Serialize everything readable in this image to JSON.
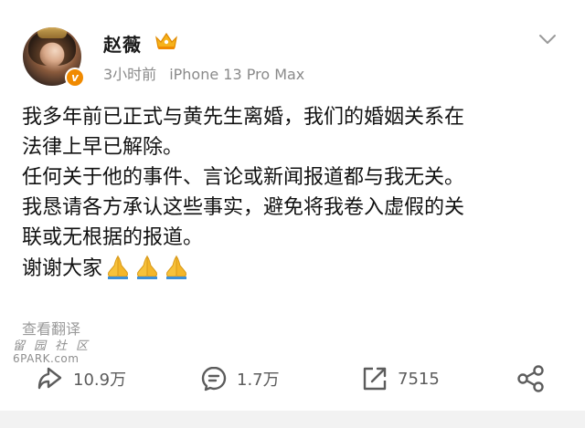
{
  "post": {
    "author_name": "赵薇",
    "verified_mark": "v",
    "time": "3小时前",
    "device": "iPhone 13 Pro Max",
    "content_lines": [
      "我多年前已正式与黄先生离婚，我们的婚姻关系在",
      "法律上早已解除。",
      "任何关于他的事件、言论或新闻报道都与我无关。",
      "我恳请各方承认这些事实，避免将我卷入虚假的关",
      "联或无根据的报道。",
      "谢谢大家"
    ],
    "emoji": "praying-hands-icon",
    "emoji_count": 3,
    "translate_label": "查看翻译"
  },
  "watermark": {
    "cn": "留园社区",
    "en": "6PARK.com"
  },
  "actions": {
    "repost_count": "10.9万",
    "comment_count": "1.7万",
    "like_count": "7515"
  },
  "colors": {
    "text": "#111111",
    "meta": "#8a8a8a",
    "verified": "#f08a00",
    "icon": "#5c5c5c"
  }
}
